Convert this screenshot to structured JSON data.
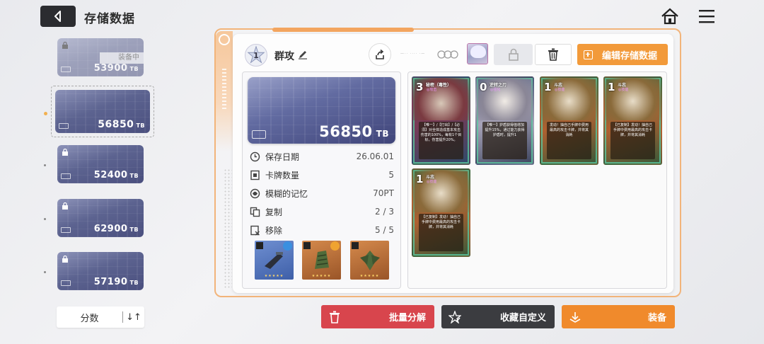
{
  "header": {
    "title": "存储数据"
  },
  "slots": [
    {
      "value": "53900",
      "unit": "TB",
      "tag": "装备中"
    },
    {
      "value": "56850",
      "unit": "TB"
    },
    {
      "value": "52400",
      "unit": "TB"
    },
    {
      "value": "62900",
      "unit": "TB"
    },
    {
      "value": "57190",
      "unit": "TB"
    }
  ],
  "sort": {
    "label": "分数",
    "icon": "↓↑"
  },
  "deck": {
    "number": "1",
    "name": "群攻",
    "capacity": "56850",
    "unit": "TB"
  },
  "toolbar": {
    "edit_label": "编辑存储数据",
    "deco": "—·· ···· ·—"
  },
  "stats": [
    {
      "label": "保存日期",
      "value": "26.06.01",
      "icon": "clock-icon"
    },
    {
      "label": "卡牌数量",
      "value": "5",
      "icon": "card-count-icon"
    },
    {
      "label": "模糊的记忆",
      "value": "70PT",
      "icon": "memory-icon"
    },
    {
      "label": "复制",
      "value": "2 / 3",
      "icon": "copy-icon"
    },
    {
      "label": "移除",
      "value": "5 / 5",
      "icon": "remove-icon"
    }
  ],
  "equipment": [
    {
      "name": "weapon",
      "stars": "★★★★★",
      "color": "#3e5fa8"
    },
    {
      "name": "armor",
      "stars": "★★★★★",
      "color": "#b0683a"
    },
    {
      "name": "accessory",
      "stars": "★★★★★",
      "color": "#b0683a"
    }
  ],
  "cards": [
    {
      "cost": "3",
      "name": "秘密（毒性）",
      "type": "◎攻击",
      "text": "【唯一】/【打出】/【必须】对全体造成基本攻击伤害的100%，每有1个目标，伤害提升20%。"
    },
    {
      "cost": "0",
      "name": "逆转之刃",
      "type": "◎强化",
      "text": "【唯一】护盾获得值增加提升15%，通过能力获得护盾时，提升1"
    },
    {
      "cost": "1",
      "name": "斗志",
      "type": "◎技能",
      "text": "发动！抽自己手牌中费用最高的攻击卡牌，并将其消耗"
    },
    {
      "cost": "1",
      "name": "斗志",
      "type": "◎技能",
      "text": "【已复制】发动！抽自己手牌中费用最高的攻击卡牌，并将其消耗"
    },
    {
      "cost": "1",
      "name": "斗志",
      "type": "◎技能",
      "text": "【已复制】发动！抽自己手牌中费用最高的攻击卡牌，并将其消耗"
    }
  ],
  "actions": {
    "decompose": "批量分解",
    "favorite": "收藏自定义",
    "equip": "装备"
  },
  "colors": {
    "accent_orange": "#f29a3a",
    "decompose_red": "#d8454d",
    "dark_button": "#3b3c40",
    "equip_orange": "#f08a2c"
  }
}
